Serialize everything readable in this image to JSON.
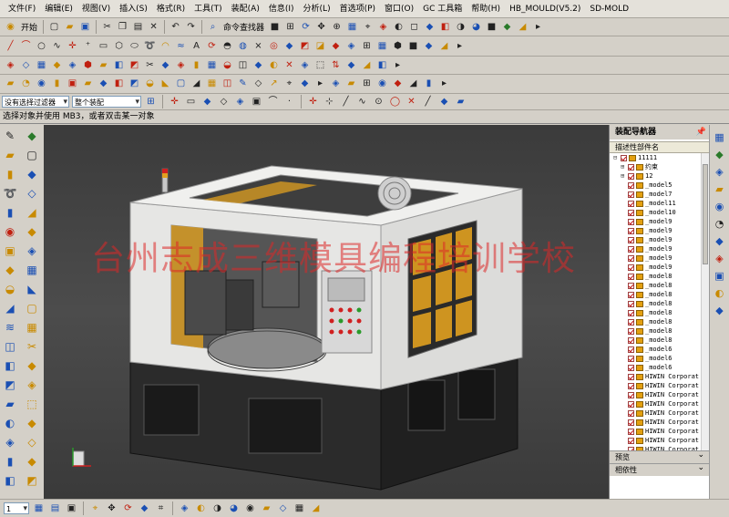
{
  "menu": [
    "文件(F)",
    "编辑(E)",
    "视图(V)",
    "插入(S)",
    "格式(R)",
    "工具(T)",
    "装配(A)",
    "信息(I)",
    "分析(L)",
    "首选项(P)",
    "窗口(O)",
    "GC 工具箱",
    "帮助(H)",
    "HB_MOULD(V5.2)",
    "SD-MOLD"
  ],
  "toolbar1": {
    "start_label": "开始",
    "command_finder_label": "命令查找器"
  },
  "selbar": {
    "filter_value": "没有选择过滤器",
    "scope_value": "整个装配"
  },
  "status_message": "选择对象并使用 MB3，或者双击某一对象",
  "watermark": "台州志成三维模具编程培训学校",
  "navigator": {
    "title": "装配导航器",
    "column_header": "描述性部件名",
    "rows": [
      {
        "text": "11111",
        "indent": 0,
        "exp": "⊟"
      },
      {
        "text": "约束",
        "indent": 1,
        "exp": "⊞"
      },
      {
        "text": "12",
        "indent": 1,
        "exp": "⊞"
      },
      {
        "text": "_model5",
        "indent": 1,
        "exp": ""
      },
      {
        "text": "_model7",
        "indent": 1,
        "exp": ""
      },
      {
        "text": "_model11",
        "indent": 1,
        "exp": ""
      },
      {
        "text": "_model10",
        "indent": 1,
        "exp": ""
      },
      {
        "text": "_model9",
        "indent": 1,
        "exp": ""
      },
      {
        "text": "_model9",
        "indent": 1,
        "exp": ""
      },
      {
        "text": "_model9",
        "indent": 1,
        "exp": ""
      },
      {
        "text": "_model9",
        "indent": 1,
        "exp": ""
      },
      {
        "text": "_model9",
        "indent": 1,
        "exp": ""
      },
      {
        "text": "_model9",
        "indent": 1,
        "exp": ""
      },
      {
        "text": "_model8",
        "indent": 1,
        "exp": ""
      },
      {
        "text": "_model8",
        "indent": 1,
        "exp": ""
      },
      {
        "text": "_model8",
        "indent": 1,
        "exp": ""
      },
      {
        "text": "_model8",
        "indent": 1,
        "exp": ""
      },
      {
        "text": "_model8",
        "indent": 1,
        "exp": ""
      },
      {
        "text": "_model8",
        "indent": 1,
        "exp": ""
      },
      {
        "text": "_model8",
        "indent": 1,
        "exp": ""
      },
      {
        "text": "_model8",
        "indent": 1,
        "exp": ""
      },
      {
        "text": "_model6",
        "indent": 1,
        "exp": ""
      },
      {
        "text": "_model6",
        "indent": 1,
        "exp": ""
      },
      {
        "text": "_model6",
        "indent": 1,
        "exp": ""
      },
      {
        "text": "HIWIN Corporat",
        "indent": 1,
        "exp": ""
      },
      {
        "text": "HIWIN Corporat",
        "indent": 1,
        "exp": ""
      },
      {
        "text": "HIWIN Corporat",
        "indent": 1,
        "exp": ""
      },
      {
        "text": "HIWIN Corporat",
        "indent": 1,
        "exp": ""
      },
      {
        "text": "HIWIN Corporat",
        "indent": 1,
        "exp": ""
      },
      {
        "text": "HIWIN Corporat",
        "indent": 1,
        "exp": ""
      },
      {
        "text": "HIWIN Corporat",
        "indent": 1,
        "exp": ""
      },
      {
        "text": "HIWIN Corporat",
        "indent": 1,
        "exp": ""
      },
      {
        "text": "HIWIN Corporat",
        "indent": 1,
        "exp": ""
      }
    ],
    "preview_label": "预览",
    "dependencies_label": "相依性"
  },
  "bottombar": {
    "layer_value": "1"
  },
  "colors": {
    "viewport_bg": "#454545",
    "cabinet_white": "#e6e6e4",
    "glass_orange": "#e0a020",
    "machine_dark": "#2a2a2a",
    "watermark_red": "#dc2828"
  }
}
